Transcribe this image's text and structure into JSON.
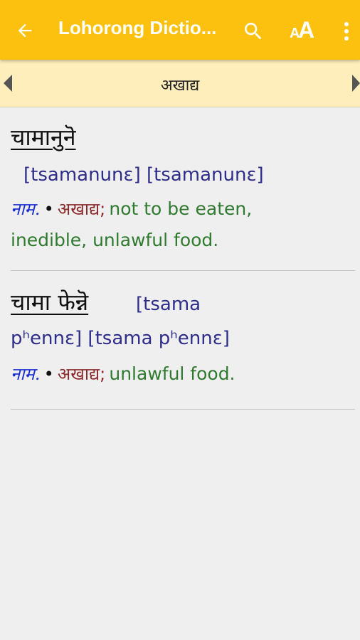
{
  "appbar": {
    "title": "Lohorong Dictio...",
    "back_icon": "arrow-left-icon",
    "search_icon": "search-icon",
    "font_icon": "font-size-icon",
    "font_icon_small": "A",
    "font_icon_big": "A",
    "more_icon": "more-vert-icon",
    "color": "#fcc10f"
  },
  "navbar": {
    "word": "अखाद्य",
    "prev_icon": "triangle-left-icon",
    "next_icon": "triangle-right-icon",
    "color": "#fdeebc"
  },
  "entries": [
    {
      "headword": "चामानुनॆ",
      "pronunciation": "[tsamanunɛ]  [tsamanunɛ]",
      "pos": "नाम.",
      "bullet": "•",
      "nepali": "अखाद्य;",
      "definition_line1": "not to be eaten,",
      "definition_line2": "inedible, unlawful food."
    },
    {
      "headword": "चामा फेन्नॆ",
      "pronunciation_line1": "[tsama",
      "pronunciation_line2": "pʰennɛ]  [tsama pʰennɛ]",
      "pos": "नाम.",
      "bullet": "•",
      "nepali": "अखाद्य;",
      "definition": "unlawful food."
    }
  ]
}
